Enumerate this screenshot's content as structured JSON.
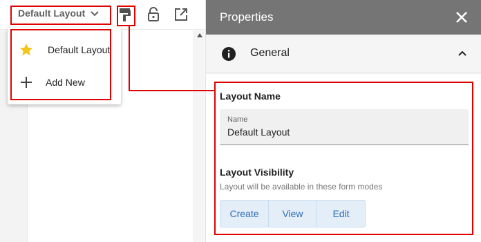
{
  "toolbar": {
    "layout_selector_label": "Default Layout",
    "icons": [
      "chevron-down-icon",
      "paint-roller-icon",
      "lock-open-icon",
      "open-external-icon"
    ]
  },
  "dropdown": {
    "items": [
      {
        "label": "Default Layout",
        "icon": "star-icon",
        "icon_color": "#f5c518"
      },
      {
        "label": "Add New",
        "icon": "plus-icon"
      }
    ]
  },
  "panel": {
    "title": "Properties",
    "close_icon": "close-icon",
    "section": {
      "title": "General",
      "icon": "info-icon",
      "collapse_icon": "chevron-up-icon",
      "layout_name": {
        "heading": "Layout Name",
        "field_caption": "Name",
        "field_value": "Default Layout"
      },
      "visibility": {
        "heading": "Layout Visibility",
        "hint": "Layout will be available in these form modes",
        "modes": [
          "Create",
          "View",
          "Edit"
        ]
      }
    }
  },
  "colors": {
    "panel_header": "#757575",
    "annotation": "#e00000",
    "mode_button_text": "#2f6db5",
    "mode_button_bg": "#e3eef9"
  }
}
